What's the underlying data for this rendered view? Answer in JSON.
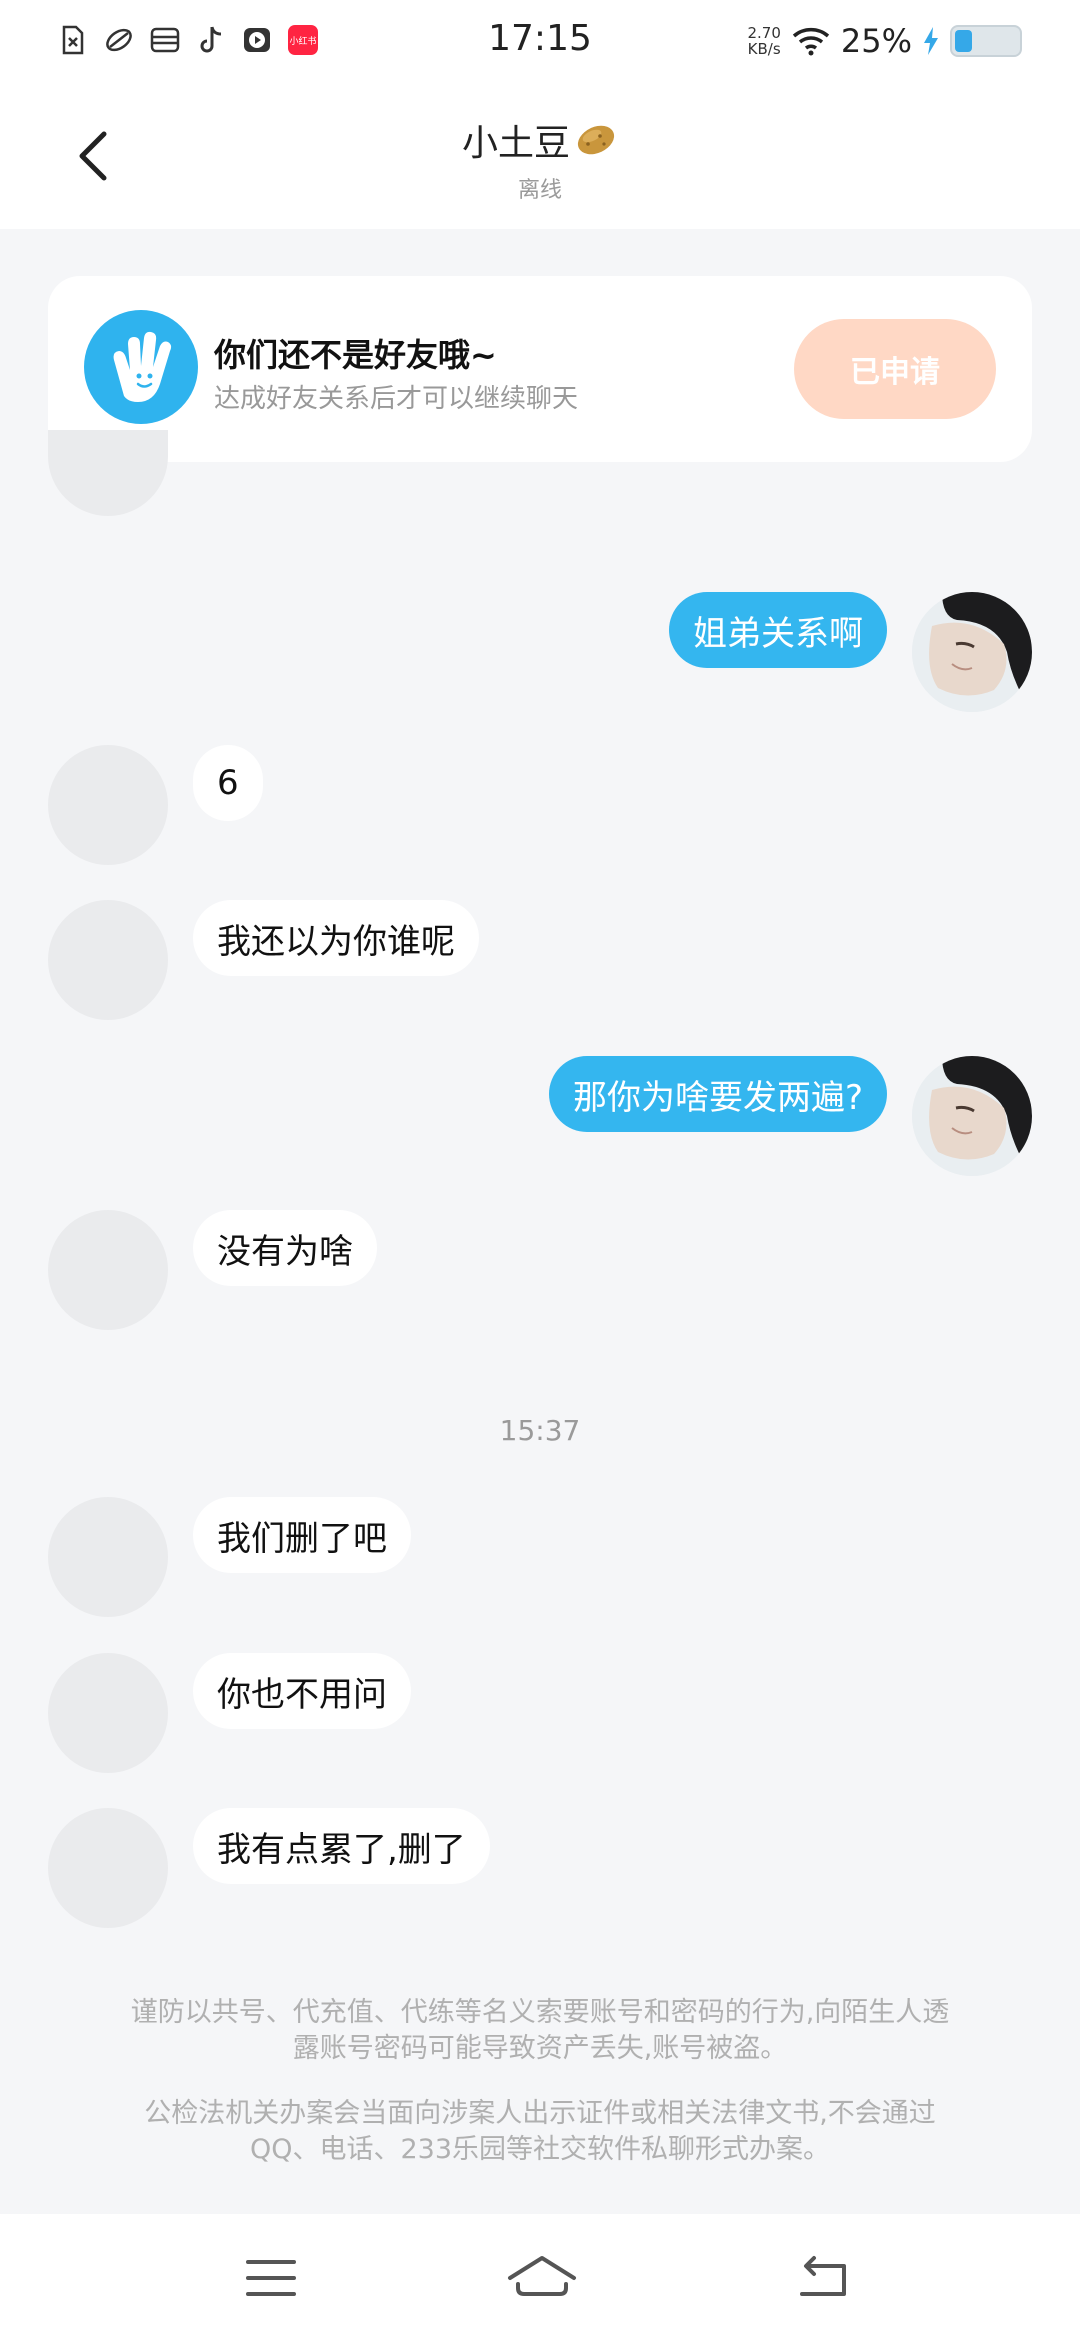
{
  "status_bar": {
    "time": "17:15",
    "net_speed_value": "2.70",
    "net_speed_unit": "KB/s",
    "battery_percent": "25%",
    "battery_level": 0.25,
    "left_icons": [
      "sim-card-icon",
      "leaf-app-icon",
      "wallet-app-icon",
      "tiktok-icon",
      "video-app-icon",
      "xiaohongshu-icon"
    ],
    "xhs_label": "小红书"
  },
  "header": {
    "title": "小土豆",
    "status": "离线"
  },
  "friend_banner": {
    "title": "你们还不是好友哦~",
    "subtitle": "达成好友关系后才可以继续聊天",
    "button_label": "已申请"
  },
  "messages": [
    {
      "side": "out",
      "text": "姐弟关系啊"
    },
    {
      "side": "in",
      "text": "6"
    },
    {
      "side": "in",
      "text": "我还以为你谁呢"
    },
    {
      "side": "out",
      "text": "那你为啥要发两遍?"
    },
    {
      "side": "in",
      "text": "没有为啥"
    },
    {
      "side": "in",
      "text": "我们删了吧"
    },
    {
      "side": "in",
      "text": "你也不用问"
    },
    {
      "side": "in",
      "text": "我有点累了,删了"
    }
  ],
  "time_divider": "15:37",
  "disclaimer": {
    "line1": "谨防以共号、代充值、代练等名义索要账号和密码的行为,向陌生人透",
    "line2": "露账号密码可能导致资产丢失,账号被盗。",
    "line3": "公检法机关办案会当面向涉案人出示证件或相关法律文书,不会通过",
    "line4": "QQ、电话、233乐园等社交软件私聊形式办案。"
  },
  "colors": {
    "accent_blue": "#34b6ef",
    "applied_button": "#ffd8c5",
    "background": "#f5f6f8"
  }
}
